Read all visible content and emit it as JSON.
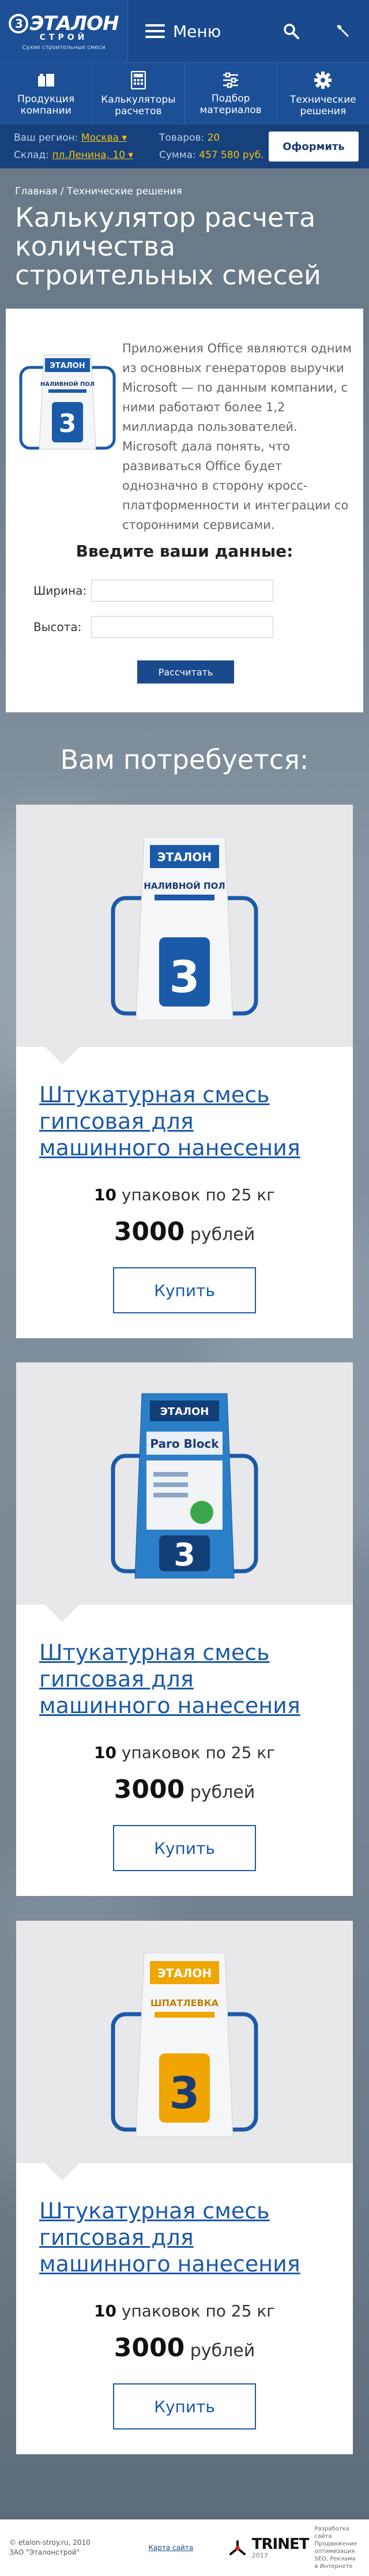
{
  "header": {
    "logo_text": "ЭТАЛОН",
    "logo_sub": "СТРОЙ",
    "logo_tagline": "Сухие строительные смеси",
    "menu_label": "Меню"
  },
  "nav": [
    {
      "label": "Продукция компании",
      "icon": "bags-icon"
    },
    {
      "label": "Калькуляторы расчетов",
      "icon": "calculator-icon"
    },
    {
      "label": "Подбор материалов",
      "icon": "sliders-icon"
    },
    {
      "label": "Технические решения",
      "icon": "gear-icon"
    }
  ],
  "infobar": {
    "region_label": "Ваш регион:",
    "region_value": "Москва ▾",
    "store_label": "Склад:",
    "store_value": "пл.Ленина, 10 ▾",
    "goods_label": "Товаров:",
    "goods_value": "20",
    "sum_label": "Сумма:",
    "sum_value": "457 580 руб.",
    "order_button": "Оформить"
  },
  "breadcrumb": "Главная / Технические решения",
  "page_title": "Калькулятор расчета количества строительных смесей",
  "calculator": {
    "description": "Приложения Office являются одним из основных генераторов выручки Microsoft — по данным компании, с ними работают более 1,2 миллиарда пользователей. Microsoft дала понять, что развиваться Office будет однозначно в сторону кросс-платформенности и интеграции со сторонними сервисами.",
    "form_title": "Введите ваши данные:",
    "width_label": "Ширина:",
    "height_label": "Высота:",
    "submit_label": "Рассчитать"
  },
  "need_title": "Вам потребуется:",
  "products": [
    {
      "name": "Штукатурная смесь гипсовая для машинного нанесения",
      "qty_number": "10",
      "qty_text": "упаковок по 25 кг",
      "price_number": "3000",
      "price_unit": "рублей",
      "buy_label": "Купить",
      "bag_color": "#1b5aa8",
      "bag_title": "НАЛИВНОЙ ПОЛ"
    },
    {
      "name": "Штукатурная смесь гипсовая для машинного нанесения",
      "qty_number": "10",
      "qty_text": "упаковок по 25 кг",
      "price_number": "3000",
      "price_unit": "рублей",
      "buy_label": "Купить",
      "bag_color": "#2a7fc8",
      "bag_title": "Paro Block"
    },
    {
      "name": "Штукатурная смесь гипсовая для машинного нанесения",
      "qty_number": "10",
      "qty_text": "упаковок по 25 кг",
      "price_number": "3000",
      "price_unit": "рублей",
      "buy_label": "Купить",
      "bag_color": "#f0a500",
      "bag_title": "ШПАТЛЕВКА"
    }
  ],
  "footer": {
    "copyright_line1": "© etalon-stroy.ru, 2010",
    "copyright_line2": "ЗАО \"Эталонстрой\"",
    "sitemap": "Карта сайта",
    "trinet": "TRINET",
    "trinet_year": "2017",
    "trinet_desc": "Разработка сайта Продвижение оптимизация SEO, Реклама в Интернете"
  }
}
